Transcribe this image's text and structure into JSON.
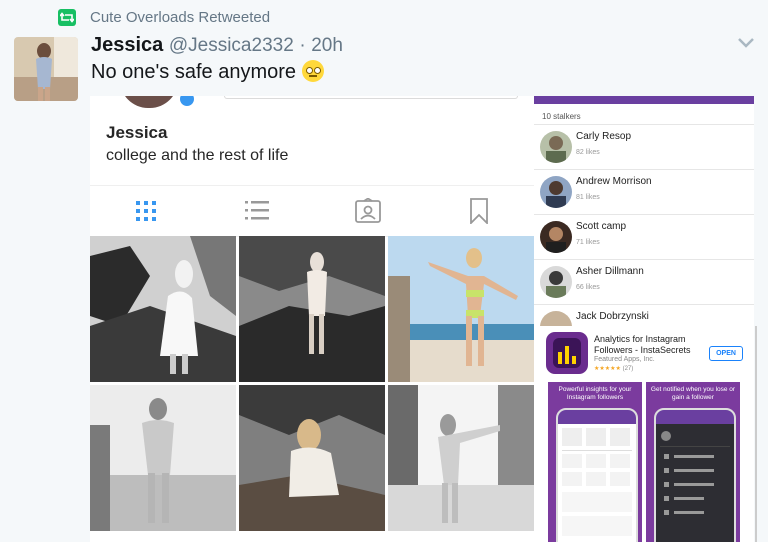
{
  "retweet": {
    "label": "Cute Overloads Retweeted",
    "icon": "retweet-icon",
    "accent": "#17bf63"
  },
  "tweet": {
    "display_name": "Jessica",
    "handle": "@Jessica2332",
    "separator": "·",
    "time": "20h",
    "text": "No one's safe  anymore",
    "emoji": "rolling-eyes-emoji",
    "menu_icon": "chevron-down-icon"
  },
  "profile_screenshot": {
    "name": "Jessica",
    "bio": "college and the rest of life",
    "tabs": [
      "grid-icon",
      "list-icon",
      "tagged-icon",
      "bookmark-icon"
    ],
    "active_tab_color": "#3897f0",
    "photos": [
      "beach-photo-1",
      "beach-photo-2",
      "beach-photo-3",
      "beach-photo-4",
      "beach-photo-5",
      "beach-photo-6"
    ]
  },
  "stalkers_screenshot": {
    "count_label": "10 stalkers",
    "accent": "#6a3fa0",
    "rows": [
      {
        "name": "Carly Resop",
        "likes": "82 likes"
      },
      {
        "name": "Andrew Morrison",
        "likes": "81 likes"
      },
      {
        "name": "Scott camp",
        "likes": "71 likes"
      },
      {
        "name": "Asher Dillmann",
        "likes": "66 likes"
      },
      {
        "name": "Jack Dobrzynski",
        "likes": ""
      }
    ]
  },
  "app_store_card": {
    "title": "Analytics for Instagram Followers - InstaSecrets",
    "developer": "Featured Apps, Inc.",
    "stars": "★★★★★",
    "rating_count": "(27)",
    "open_label": "OPEN",
    "promos": [
      {
        "caption": "Powerful insights for your Instagram followers"
      },
      {
        "caption": "Get notified when you lose or gain a follower"
      }
    ]
  }
}
